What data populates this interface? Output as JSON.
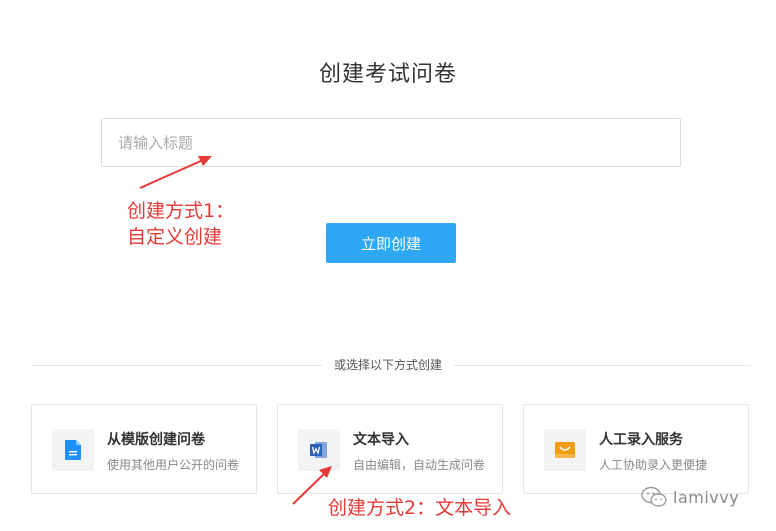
{
  "header": {
    "title": "创建考试问卷"
  },
  "form": {
    "title_placeholder": "请输入标题",
    "title_value": "",
    "create_button": "立即创建"
  },
  "annotations": {
    "method1_line1": "创建方式1：",
    "method1_line2": "自定义创建",
    "method2": "创建方式2：文本导入"
  },
  "alternatives": {
    "divider_label": "或选择以下方式创建",
    "cards": [
      {
        "title": "从模版创建问卷",
        "desc": "使用其他用户公开的问卷",
        "icon": "document-icon"
      },
      {
        "title": "文本导入",
        "desc": "自由编辑，自动生成问卷",
        "icon": "word-icon"
      },
      {
        "title": "人工录入服务",
        "desc": "人工协助录入更便捷",
        "icon": "service-icon"
      }
    ]
  },
  "watermark": {
    "text": "lamivvy"
  },
  "colors": {
    "primary": "#2ea7f5",
    "annotation": "#e53935",
    "doc_icon": "#1e90ff",
    "word_icon": "#2b5fb8",
    "service_icon": "#f39c12"
  }
}
